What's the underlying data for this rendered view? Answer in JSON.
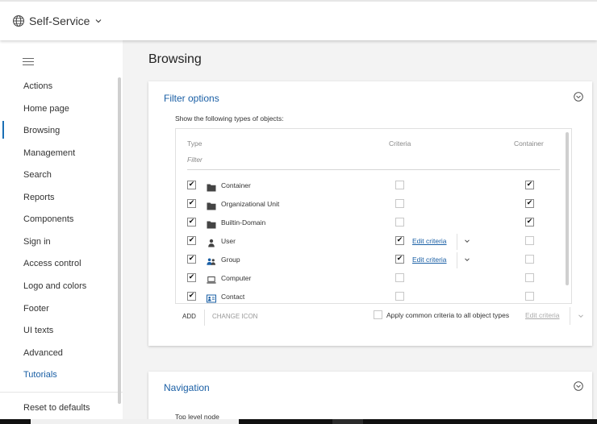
{
  "topbar": {
    "title": "Self-Service",
    "icon": "globe-icon"
  },
  "sidebar": {
    "items": [
      {
        "label": "Actions"
      },
      {
        "label": "Home page"
      },
      {
        "label": "Browsing",
        "active": true
      },
      {
        "label": "Management"
      },
      {
        "label": "Search"
      },
      {
        "label": "Reports"
      },
      {
        "label": "Components"
      },
      {
        "label": "Sign in"
      },
      {
        "label": "Access control"
      },
      {
        "label": "Logo and colors"
      },
      {
        "label": "Footer"
      },
      {
        "label": "UI texts"
      },
      {
        "label": "Advanced"
      },
      {
        "label": "Tutorials",
        "accent": true
      }
    ],
    "reset_label": "Reset to defaults"
  },
  "main": {
    "title": "Browsing",
    "filter_card": {
      "title": "Filter options",
      "subtitle": "Show the following types of objects:",
      "columns": {
        "type": "Type",
        "criteria": "Criteria",
        "container": "Container"
      },
      "filter_placeholder": "Filter",
      "rows": [
        {
          "label": "Container",
          "icon": "folder-icon",
          "enabled": true,
          "criteria": false,
          "edit_label": "",
          "container": true
        },
        {
          "label": "Organizational Unit",
          "icon": "folder-icon",
          "enabled": true,
          "criteria": false,
          "edit_label": "",
          "container": true
        },
        {
          "label": "Builtin-Domain",
          "icon": "folder-icon",
          "enabled": true,
          "criteria": false,
          "edit_label": "",
          "container": true
        },
        {
          "label": "User",
          "icon": "user-icon",
          "enabled": true,
          "criteria": true,
          "edit_label": "Edit criteria",
          "container": false
        },
        {
          "label": "Group",
          "icon": "group-icon",
          "enabled": true,
          "criteria": true,
          "edit_label": "Edit criteria",
          "container": false
        },
        {
          "label": "Computer",
          "icon": "computer-icon",
          "enabled": true,
          "criteria": false,
          "edit_label": "",
          "container": false
        },
        {
          "label": "Contact",
          "icon": "contact-card-icon",
          "enabled": true,
          "criteria": false,
          "edit_label": "",
          "container": false
        }
      ],
      "add_label": "ADD",
      "change_icon_label": "CHANGE ICON",
      "apply_common_label": "Apply common criteria to all object types",
      "edit_criteria_label": "Edit criteria"
    },
    "navigation_card": {
      "title": "Navigation",
      "top_level_label": "Top level node"
    }
  },
  "colors": {
    "accent": "#1a5fa5",
    "active_bar": "#1a6fb5"
  }
}
